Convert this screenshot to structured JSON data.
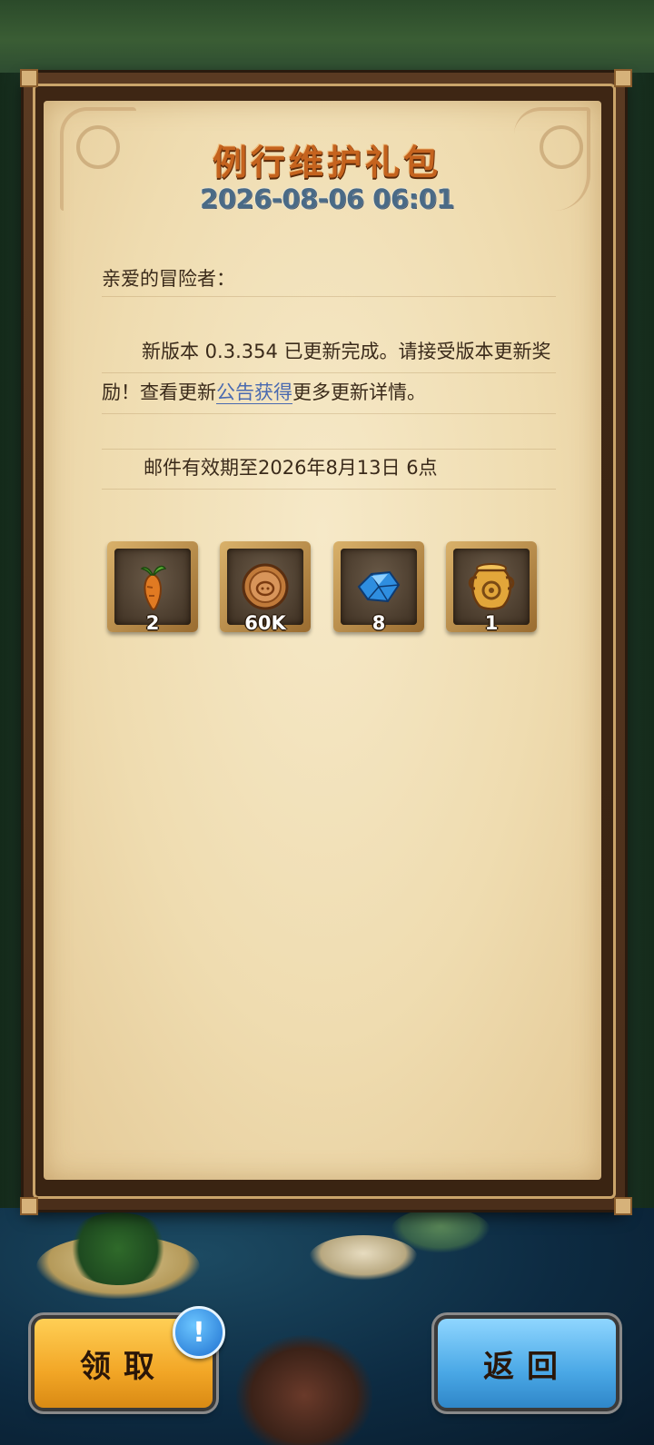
{
  "mail": {
    "title": "例行维护礼包",
    "date": "2026-08-06 06:01",
    "greeting": "亲爱的冒险者：",
    "para_part1": "新版本 0.3.354 已更新完成。请接受版本更新奖励！查看更新",
    "para_link": "公告获得",
    "para_part2": "更多更新详情。",
    "expiry": "邮件有效期至2026年8月13日 6点"
  },
  "rewards": [
    {
      "icon": "carrot-icon",
      "qty": "2"
    },
    {
      "icon": "coin-icon",
      "qty": "60K"
    },
    {
      "icon": "crystal-icon",
      "qty": "8"
    },
    {
      "icon": "urn-icon",
      "qty": "1"
    }
  ],
  "buttons": {
    "claim": "领取",
    "back": "返回",
    "badge": "!"
  },
  "colors": {
    "title": "#c5631e",
    "date": "#4a6a86",
    "link": "#4a6ab0",
    "claim_button": "#f2a626",
    "back_button": "#4aa8e6"
  }
}
